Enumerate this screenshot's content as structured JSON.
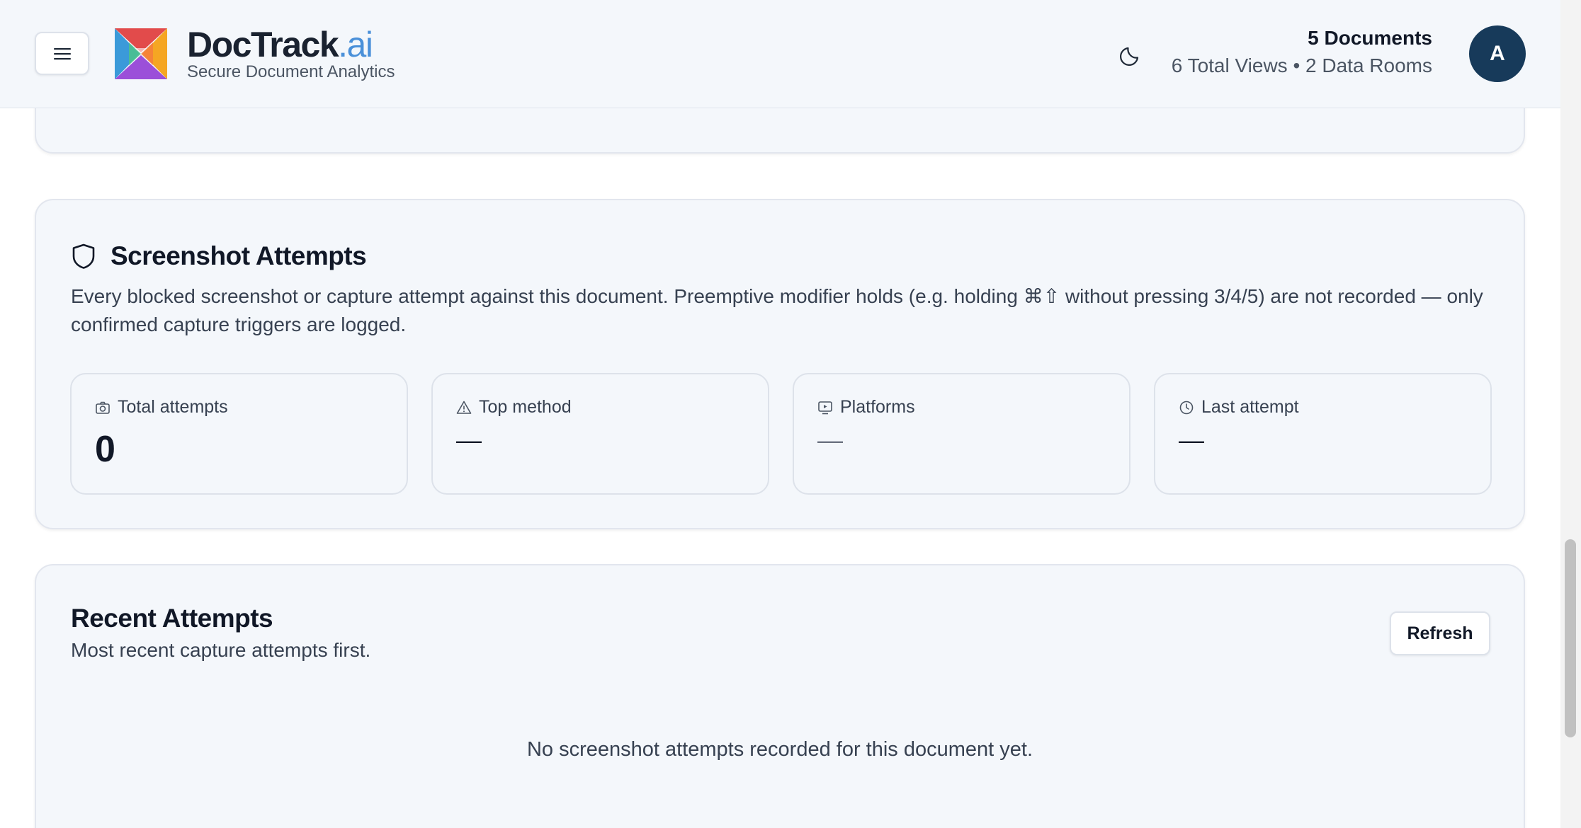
{
  "header": {
    "brand_name": "DocTrack",
    "brand_suffix": ".ai",
    "tagline": "Secure Document Analytics",
    "documents_count": "5 Documents",
    "views_summary": "6 Total Views • 2 Data Rooms",
    "avatar_initial": "A"
  },
  "icons": {
    "menu": "hamburger-icon",
    "logo": "doctrack-logo",
    "theme": "moon-icon",
    "section": "shield-icon",
    "total_attempts": "camera-icon",
    "top_method": "warning-triangle-icon",
    "platforms": "monitor-icon",
    "last_attempt": "clock-icon"
  },
  "screenshot_attempts": {
    "title": "Screenshot Attempts",
    "description": "Every blocked screenshot or capture attempt against this document. Preemptive modifier holds (e.g. holding ⌘⇧ without pressing 3/4/5) are not recorded — only confirmed capture triggers are logged.",
    "stats": {
      "total_attempts": {
        "label": "Total attempts",
        "value": "0"
      },
      "top_method": {
        "label": "Top method",
        "value": "—"
      },
      "platforms": {
        "label": "Platforms",
        "value": "—"
      },
      "last_attempt": {
        "label": "Last attempt",
        "value": "—"
      }
    }
  },
  "recent_attempts": {
    "title": "Recent Attempts",
    "subtitle": "Most recent capture attempts first.",
    "refresh_label": "Refresh",
    "empty_message": "No screenshot attempts recorded for this document yet."
  },
  "colors": {
    "brand_accent": "#4a90d9",
    "avatar_bg": "#173a5a",
    "header_bg": "#f4f7fb",
    "card_bg": "#f4f7fb"
  }
}
